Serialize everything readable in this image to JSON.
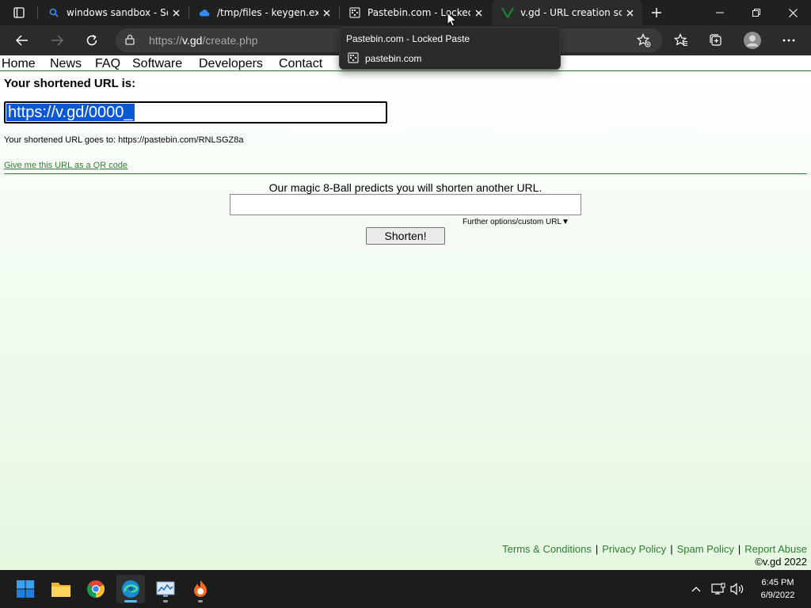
{
  "browser": {
    "tabs": [
      {
        "title": "windows sandbox - Sea",
        "favicon": "search-icon"
      },
      {
        "title": "/tmp/files - keygen.exe",
        "favicon": "cloud-icon"
      },
      {
        "title": "Pastebin.com - Locked",
        "favicon": "pastebin-icon"
      },
      {
        "title": "v.gd - URL creation scri",
        "favicon": "vgd-icon",
        "active": true
      }
    ],
    "address": {
      "prefix": "https://",
      "domain": "v.gd",
      "path": "/create.php"
    },
    "tooltip": {
      "title": "Pastebin.com - Locked Paste",
      "domain": "pastebin.com"
    }
  },
  "page": {
    "nav": [
      "Home",
      "News",
      "FAQ",
      "Software",
      "Developers",
      "Contact"
    ],
    "shortened_label": "Your shortened URL is:",
    "short_url": "https://v.gd/0000_",
    "goes_to": "Your shortened URL goes to: https://pastebin.com/RNLSGZ8a",
    "qr_link": "Give me this URL as a QR code",
    "magic_text": "Our magic 8-Ball predicts you will shorten another URL.",
    "long_url_value": "",
    "further_options": "Further options/custom URL▼",
    "shorten_button": "Shorten!",
    "footer": {
      "terms": "Terms & Conditions",
      "privacy": "Privacy Policy",
      "spam": "Spam Policy",
      "abuse": "Report Abuse",
      "separator": "|",
      "copyright": "©v.gd 2022"
    }
  },
  "taskbar": {
    "apps": [
      "start-icon",
      "file-explorer-icon",
      "chrome-icon",
      "edge-icon",
      "resource-monitor-icon",
      "burp-icon"
    ],
    "clock": {
      "time": "6:45 PM",
      "date": "6/9/2022"
    }
  },
  "colors": {
    "link_green": "#2e7d32",
    "selection_blue": "#0a58d6",
    "browser_dark": "#202020",
    "edge_accent": "#4cc2ff"
  }
}
